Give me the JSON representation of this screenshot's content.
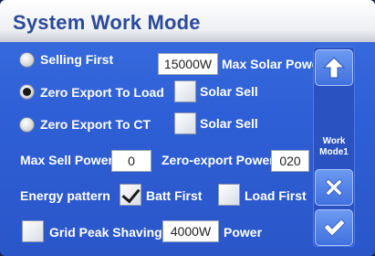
{
  "title": "System Work Mode",
  "modes": {
    "selling_first": "Selling First",
    "zero_export_load": "Zero Export To Load",
    "zero_export_ct": "Zero Export To CT",
    "selected": "zero_export_load"
  },
  "max_solar_power": {
    "value": "15000W",
    "label": "Max Solar Power"
  },
  "solar_sell_load": {
    "label": "Solar Sell",
    "checked": false
  },
  "solar_sell_ct": {
    "label": "Solar Sell",
    "checked": false
  },
  "max_sell_power": {
    "label": "Max Sell Power",
    "value": "0"
  },
  "zero_export_power": {
    "label": "Zero-export Power",
    "value": "020"
  },
  "energy_pattern": {
    "label": "Energy pattern",
    "batt_first": {
      "label": "Batt First",
      "checked": true
    },
    "load_first": {
      "label": "Load First",
      "checked": false
    }
  },
  "grid_peak": {
    "label": "Grid Peak Shaving",
    "value": "4000W",
    "unit": "Power",
    "checked": false
  },
  "sidebar": {
    "mode_label_line1": "Work",
    "mode_label_line2": "Mode1",
    "icons": [
      "arrow-up-icon",
      "arrow-down-icon",
      "cancel-icon",
      "confirm-icon"
    ]
  },
  "colors": {
    "background": "#2f5fd6",
    "title_text": "#2b4a9c",
    "label_text": "#ffffff"
  }
}
